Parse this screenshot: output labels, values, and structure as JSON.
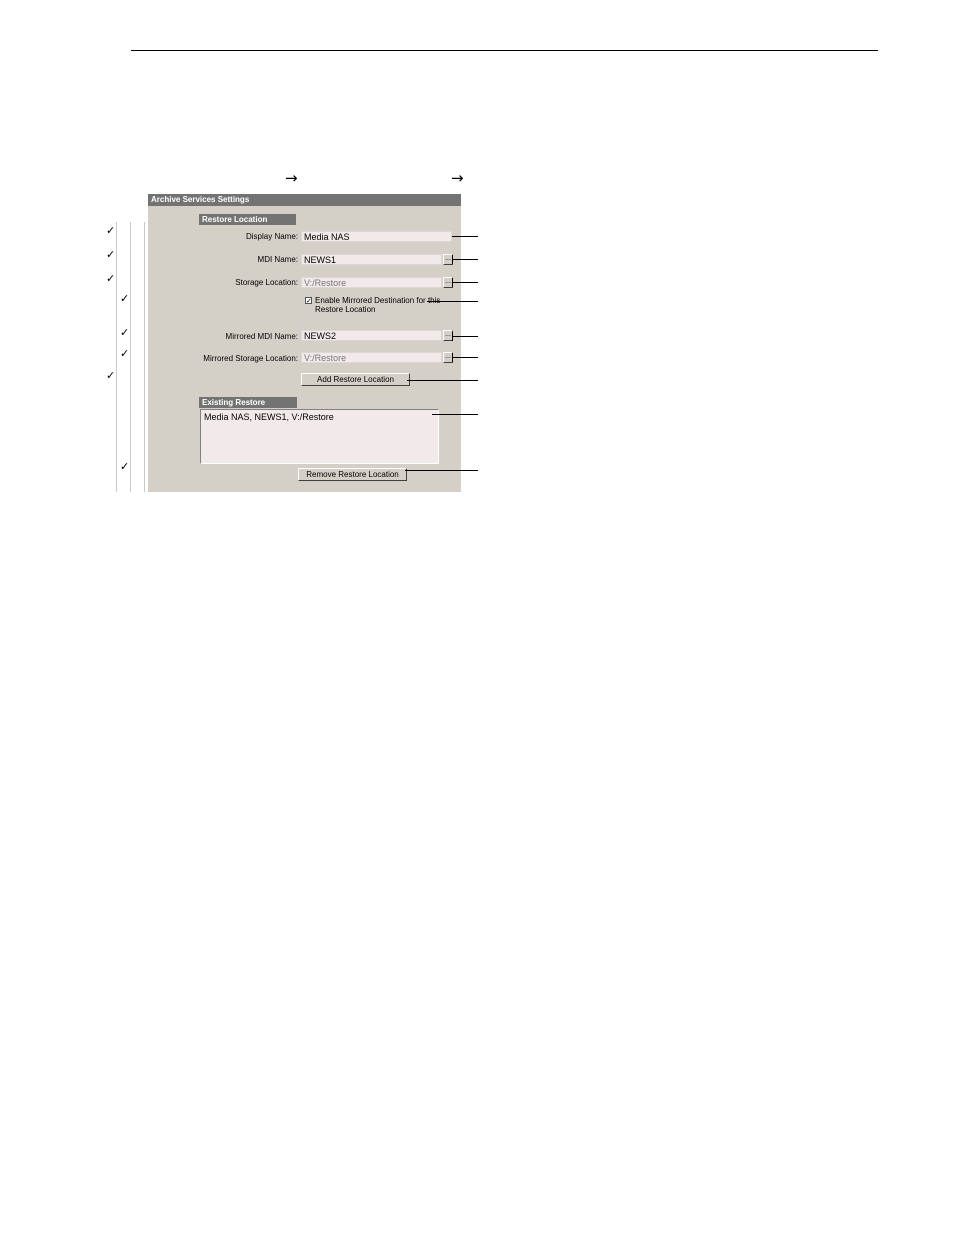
{
  "header": {
    "nav_arrows": [
      "→",
      "→"
    ]
  },
  "dialog": {
    "title": "Archive Services Settings",
    "restore_location": {
      "group_title": "Restore Location",
      "display_name": {
        "label": "Display Name:",
        "value": "Media NAS"
      },
      "mdi_name": {
        "label": "MDI Name:",
        "value": "NEWS1",
        "browse": "..."
      },
      "storage_location": {
        "label": "Storage Location:",
        "value": "V:/Restore",
        "browse": "..."
      },
      "enable_mirrored": {
        "checked": true,
        "check_glyph": "✓",
        "label_line1": "Enable Mirrored Destination for this",
        "label_line2": "Restore Location"
      },
      "mirrored_mdi_name": {
        "label": "Mirrored MDI Name:",
        "value": "NEWS2",
        "browse": "..."
      },
      "mirrored_storage_location": {
        "label": "Mirrored Storage Location:",
        "value": "V:/Restore",
        "browse": "..."
      },
      "add_button": "Add Restore Location"
    },
    "existing": {
      "group_title": "Existing Restore Locations",
      "items": [
        "Media NAS, NEWS1, V:/Restore"
      ],
      "remove_button": "Remove Restore Location"
    }
  },
  "checklist_marks": [
    "✓",
    "✓",
    "✓",
    "✓",
    "✓",
    "✓",
    "✓",
    "✓"
  ]
}
